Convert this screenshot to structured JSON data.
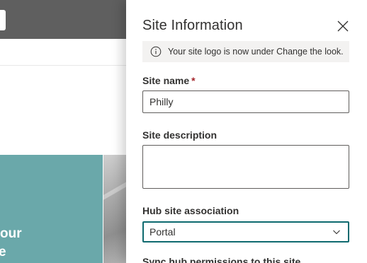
{
  "background": {
    "tile_text_line1": "our",
    "tile_text_line2": "e"
  },
  "panel": {
    "title": "Site Information",
    "info_message": "Your site logo is now under Change the look.",
    "site_name": {
      "label": "Site name",
      "required_marker": "*",
      "value": "Philly"
    },
    "site_description": {
      "label": "Site description",
      "value": ""
    },
    "hub_site_association": {
      "label": "Hub site association",
      "selected": "Portal"
    },
    "sync_hub_permissions": {
      "label": "Sync hub permissions to this site"
    }
  },
  "icons": {
    "close": "close-icon",
    "info": "info-icon",
    "chevron": "chevron-down-icon"
  },
  "colors": {
    "dropdown_border_focus": "#0e6a6f",
    "required": "#a4262c",
    "background_tile_teal": "#6aa8aa",
    "info_bar_bg": "#f3f2f1"
  }
}
